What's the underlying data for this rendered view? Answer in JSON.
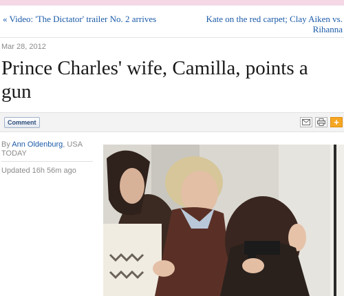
{
  "nav": {
    "prev_arrow": "«",
    "prev_link": "Video: 'The Dictator' trailer No. 2 arrives",
    "next_link": "Kate on the red carpet; Clay Aiken vs. Rihanna",
    "next_arrow": "»"
  },
  "article": {
    "date": "Mar 28, 2012",
    "headline": "Prince Charles' wife, Camilla, points a gun",
    "byline_prefix": "By",
    "author": "Ann Oldenburg",
    "source": ", USA TODAY",
    "updated": "Updated 16h 56m ago"
  },
  "toolbar": {
    "comment_label": "Comment",
    "icons": [
      "email-icon",
      "print-icon",
      "share-plus-icon"
    ],
    "plus_glyph": "+"
  },
  "colors": {
    "link": "#1a5aa8",
    "muted_text": "#8a8a8a",
    "top_strip": "#f4d8e6",
    "share_orange": "#f5a623"
  }
}
